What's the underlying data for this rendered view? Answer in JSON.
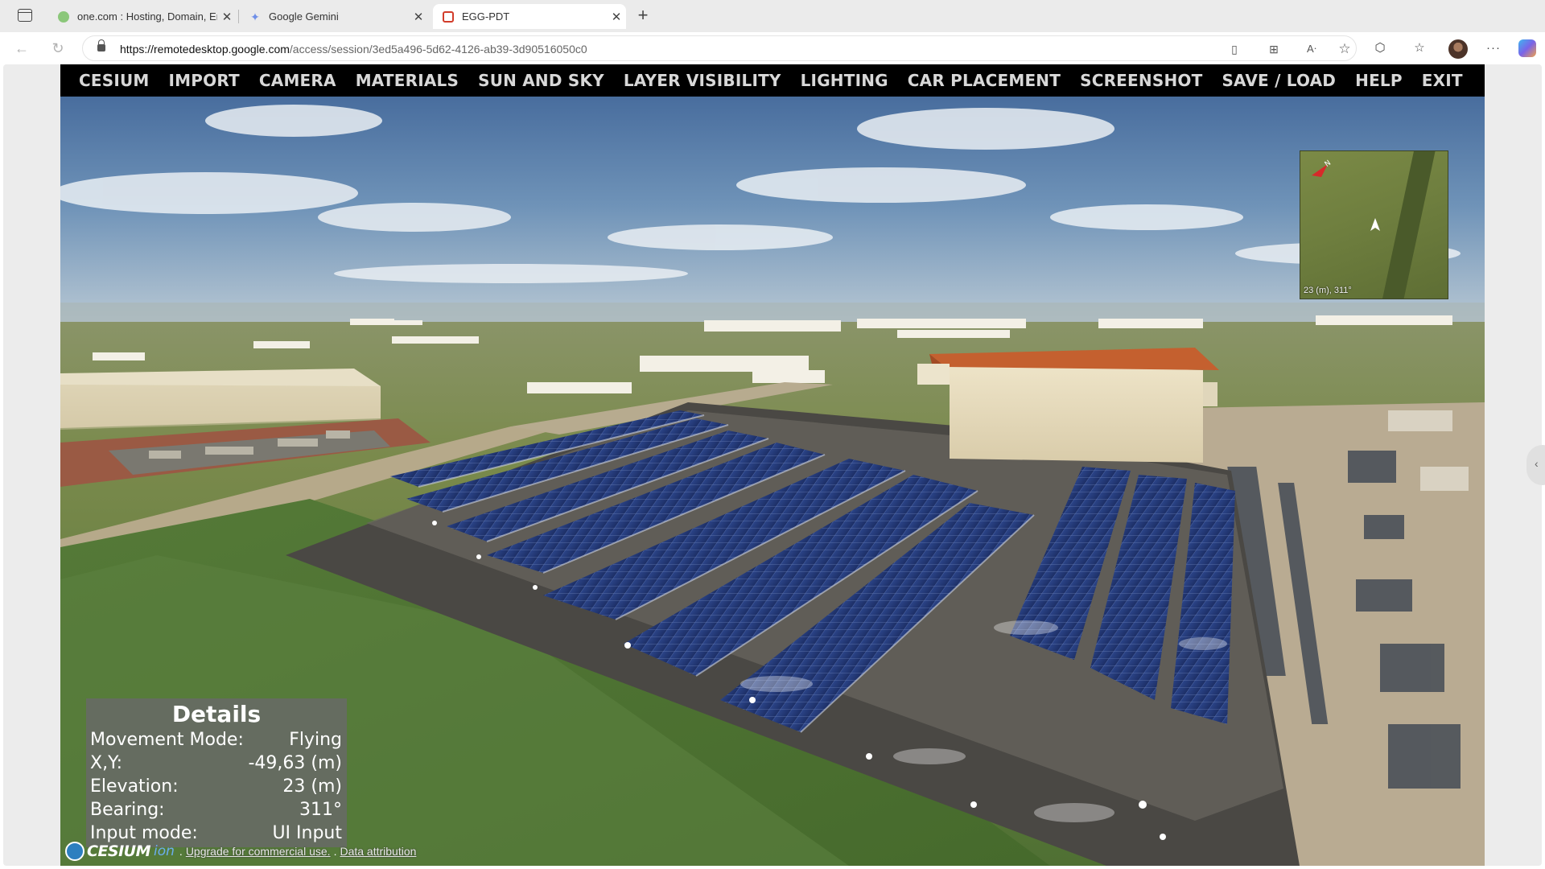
{
  "browser": {
    "tabs": [
      {
        "title": "one.com : Hosting, Domain, Email",
        "active": false
      },
      {
        "title": "Google Gemini",
        "active": false
      },
      {
        "title": "EGG-PDT",
        "active": true
      }
    ],
    "url_host": "https://remotedesktop.google.com",
    "url_path": "/access/session/3ed5a496-5d62-4126-ab39-3d90516050c0",
    "icons": [
      "sidebar-toggle-icon",
      "back-icon",
      "reload-icon",
      "lock-icon",
      "save-page-icon",
      "app-install-icon",
      "read-aloud-icon",
      "favorite-star-icon",
      "extensions-icon",
      "favorites-icon",
      "profile-avatar",
      "more-icon",
      "copilot-icon"
    ]
  },
  "menu": {
    "items": [
      "CESIUM",
      "IMPORT",
      "CAMERA",
      "MATERIALS",
      "SUN AND SKY",
      "LAYER VISIBILITY",
      "LIGHTING",
      "CAR PLACEMENT",
      "SCREENSHOT",
      "SAVE / LOAD",
      "HELP",
      "EXIT"
    ]
  },
  "minimap": {
    "label": "23 (m), 311°"
  },
  "details": {
    "title": "Details",
    "rows": [
      {
        "label": "Movement Mode:",
        "value": "Flying"
      },
      {
        "label": "X,Y:",
        "value": "-49,63 (m)"
      },
      {
        "label": "Elevation:",
        "value": "23 (m)"
      },
      {
        "label": "Bearing:",
        "value": "311°"
      },
      {
        "label": "Input mode:",
        "value": "UI Input"
      }
    ]
  },
  "credits": {
    "logo_text": "CESIUM",
    "logo_suffix": "ion",
    "upgrade_link": "Upgrade for commercial use.",
    "separator": ".",
    "attribution_link": "Data attribution"
  },
  "colors": {
    "menu_bg": "#000000",
    "menu_text": "#d8d8d8",
    "details_bg": "#696969",
    "roof_tiles": "#c4602f",
    "solar_panel": "#2a3f78"
  }
}
